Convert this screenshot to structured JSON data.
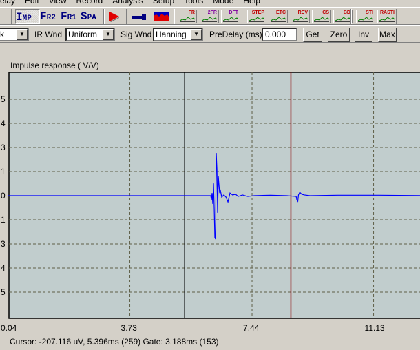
{
  "menu": [
    "elay",
    "Edit",
    "View",
    "Record",
    "Analysis",
    "Setup",
    "Tools",
    "Mode",
    "Help"
  ],
  "modes": [
    {
      "a": "I",
      "b": "MP"
    },
    {
      "a": "F",
      "b": "R2"
    },
    {
      "a": "F",
      "b": "R1"
    },
    {
      "a": "S",
      "b": "PA"
    }
  ],
  "tools": [
    "FR",
    "2FR",
    "DFT",
    "STEP",
    "ETC",
    "REV",
    "CS",
    "BD",
    "STI",
    "RASTI"
  ],
  "toolbar2": {
    "first_combo": "k",
    "ir_wnd_label": "IR Wnd",
    "ir_wnd": "Uniform",
    "sig_wnd_label": "Sig Wnd",
    "sig_wnd": "Hanning",
    "predelay_label": "PreDelay (ms)",
    "predelay": "0.000",
    "get": "Get",
    "zero": "Zero",
    "inv": "Inv",
    "max": "Max"
  },
  "colors": {
    "plot_bg": "#c1cdcd",
    "trace": "#0000ff",
    "gate": "#8b0000",
    "cursor": "#000000",
    "grid": "#606048"
  },
  "chart_data": {
    "type": "line",
    "title": "Impulse response ( V/V)",
    "xticks": [
      "0.04",
      "3.73",
      "7.44",
      "11.13"
    ],
    "xtick_values": [
      0.04,
      3.73,
      7.44,
      11.13
    ],
    "yticks": [
      "5",
      "4",
      "3",
      "1",
      "0",
      "1",
      "3",
      "4",
      "5"
    ],
    "ytick_values": [
      4,
      3,
      2,
      1,
      0,
      -1,
      -2,
      -3,
      -4
    ],
    "cursor_ms": 5.396,
    "gate_ms": 8.62,
    "series": [
      {
        "name": "Impulse response",
        "points": [
          [
            0.04,
            0
          ],
          [
            6.186,
            0
          ],
          [
            6.207,
            -0.17
          ],
          [
            6.227,
            0.11
          ],
          [
            6.249,
            -0.34
          ],
          [
            6.269,
            0.51
          ],
          [
            6.291,
            -0.51
          ],
          [
            6.311,
            -1.74
          ],
          [
            6.332,
            -1.8
          ],
          [
            6.353,
            1.77
          ],
          [
            6.374,
            1.11
          ],
          [
            6.395,
            -0.71
          ],
          [
            6.416,
            0.8
          ],
          [
            6.436,
            0.46
          ],
          [
            6.457,
            0.11
          ],
          [
            6.478,
            0.23
          ],
          [
            6.52,
            -0.06
          ],
          [
            6.583,
            0.03
          ],
          [
            6.646,
            -0.05
          ],
          [
            6.71,
            -0.26
          ],
          [
            6.77,
            0.11
          ],
          [
            6.85,
            0.03
          ],
          [
            6.94,
            0.06
          ],
          [
            7.02,
            -0.03
          ],
          [
            7.15,
            0.03
          ],
          [
            7.31,
            -0.03
          ],
          [
            7.5,
            0
          ],
          [
            8.0,
            0.02
          ],
          [
            8.5,
            0
          ],
          [
            8.78,
            -0.03
          ],
          [
            8.8,
            -0.17
          ],
          [
            8.83,
            -0.23
          ],
          [
            8.85,
            0.03
          ],
          [
            8.89,
            0.14
          ],
          [
            8.95,
            0.06
          ],
          [
            9.03,
            0.03
          ],
          [
            9.2,
            0
          ],
          [
            10.03,
            0.02
          ],
          [
            11.29,
            0.02
          ],
          [
            13,
            0
          ]
        ]
      }
    ]
  },
  "status": "Cursor: -207.116 uV, 5.396ms (259)  Gate: 3.188ms (153)"
}
